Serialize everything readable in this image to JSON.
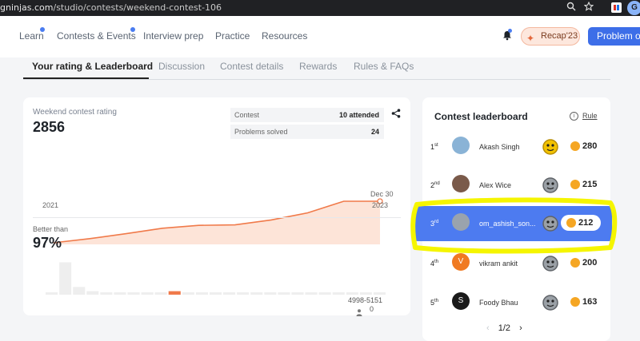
{
  "browser": {
    "url_host": "gninjas.com",
    "url_path": "/studio/contests/weekend-contest-106",
    "zoom_icon": "zoom-icon",
    "star_icon": "star-icon",
    "ext_profile_letter": "G"
  },
  "topnav": {
    "items": [
      {
        "label": "Learn",
        "dot": true
      },
      {
        "label": "Contests & Events",
        "dot": true
      },
      {
        "label": "Interview prep",
        "dot": false
      },
      {
        "label": "Practice",
        "dot": false
      },
      {
        "label": "Resources",
        "dot": false
      }
    ],
    "recap_label": "Recap'23",
    "problem_button": "Problem of"
  },
  "tabs": [
    {
      "label": "Your rating & Leaderboard",
      "active": true
    },
    {
      "label": "Discussion",
      "active": false
    },
    {
      "label": "Contest details",
      "active": false
    },
    {
      "label": "Rewards",
      "active": false
    },
    {
      "label": "Rules & FAQs",
      "active": false
    }
  ],
  "rating": {
    "label": "Weekend contest rating",
    "value": "2856",
    "stats": [
      {
        "key": "Contest",
        "value": "10 attended"
      },
      {
        "key": "Problems solved",
        "value": "24"
      }
    ],
    "chart_start_label": "2021",
    "chart_end_label": "2023",
    "chart_hover_label": "Dec 30",
    "trend": [
      0.0,
      0.1,
      0.22,
      0.35,
      0.42,
      0.43,
      0.55,
      0.72,
      1.0,
      1.0
    ]
  },
  "percentile": {
    "label": "Better than",
    "value": "97%",
    "range_label": "4998-5151",
    "count": "0",
    "histogram": [
      0.05,
      0.92,
      0.22,
      0.1,
      0.05,
      0.05,
      0.05,
      0.05,
      0.05,
      0.1,
      0.05,
      0.05,
      0.05,
      0.05,
      0.05,
      0.05,
      0.05,
      0.05,
      0.05,
      0.05,
      0.05,
      0.05,
      0.05,
      0.05,
      0.05
    ],
    "highlight_index": 9
  },
  "leaderboard": {
    "title": "Contest leaderboard",
    "rule_label": "Rule",
    "rows": [
      {
        "rank": "1",
        "suffix": "st",
        "name": "Akash Singh",
        "score": "280",
        "avatar_color": "#8ab3d6",
        "avatar_letter": "",
        "badge": "gold",
        "highlight": false
      },
      {
        "rank": "2",
        "suffix": "nd",
        "name": "Alex Wice",
        "score": "215",
        "avatar_color": "#7a5a4a",
        "avatar_letter": "",
        "badge": "silver",
        "highlight": false
      },
      {
        "rank": "3",
        "suffix": "rd",
        "name": "om_ashish_son...",
        "score": "212",
        "avatar_color": "#9aa3ad",
        "avatar_letter": "",
        "badge": "silver",
        "highlight": true
      },
      {
        "rank": "4",
        "suffix": "th",
        "name": "vikram ankit",
        "score": "200",
        "avatar_color": "#f07a22",
        "avatar_letter": "V",
        "badge": "silver",
        "highlight": false
      },
      {
        "rank": "5",
        "suffix": "th",
        "name": "Foody Bhau",
        "score": "163",
        "avatar_color": "#1a1a1a",
        "avatar_letter": "S",
        "badge": "silver",
        "highlight": false
      }
    ],
    "page_label": "1/2"
  },
  "colors": {
    "accent": "#4d7bf0",
    "chart_line": "#f07a4a",
    "chart_fill": "#fde4d8",
    "highlight_marker": "#f5f500"
  }
}
